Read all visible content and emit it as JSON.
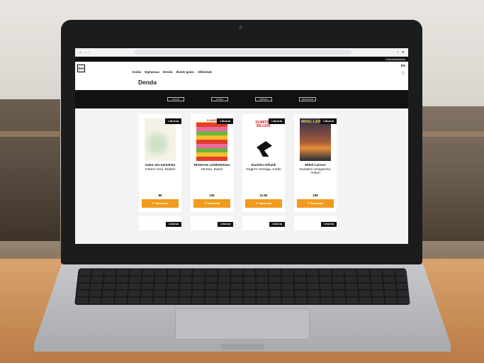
{
  "browser": {
    "url": "..."
  },
  "site": {
    "logo": "DAI",
    "top_right": "Dokumentazioa",
    "lang": "ES",
    "nav": [
      "Azoka",
      "Egitaraua",
      "Denda",
      "Ikusle gaiza",
      "Albisteak"
    ],
    "page_title": "Denda",
    "categories": [
      "Liburua",
      "Musika",
      "Albiberia",
      "Bestelakoak"
    ]
  },
  "products": [
    {
      "badge": "Liburua",
      "title": "Xatur eta taimeleta",
      "author": "Yubero Ona, Beatriz",
      "price": "8€",
      "button": "Saskiratu"
    },
    {
      "badge": "Liburua",
      "title": "Elmerren urtebetetzea",
      "author": "McKee, David",
      "price": "13€",
      "button": "Saskiratu"
    },
    {
      "badge": "Liburua",
      "title": "Dumitru biluzik",
      "author": "Izagirre Urreaga, Koldo",
      "price": "11.5€",
      "button": "Saskiratu"
    },
    {
      "badge": "Liburua",
      "title": "Mikel Larson",
      "author": "Kazabon Amigorena, Antton",
      "price": "10€",
      "button": "Saskiratu"
    }
  ],
  "second_row_badges": [
    "Liburua",
    "Liburua",
    "Liburua",
    "Liburua"
  ],
  "cover_texts": [
    "ELMER",
    "DUMITRU BILUZIK",
    "MIKEL LAR"
  ]
}
